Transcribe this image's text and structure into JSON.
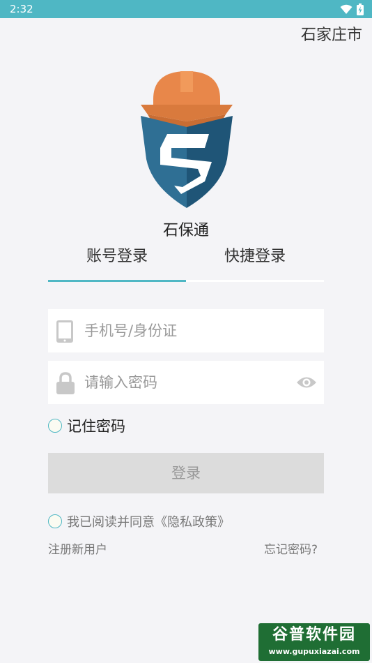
{
  "status_bar": {
    "time": "2:32",
    "icons": [
      "wifi-icon",
      "battery-icon"
    ]
  },
  "header": {
    "city": "石家庄市"
  },
  "app": {
    "name": "石保通",
    "logo_icon": "shield-helmet-logo",
    "colors": {
      "accent": "#4fb7c4",
      "logo_orange": "#e8874a",
      "logo_blue": "#2f6f94"
    }
  },
  "tabs": [
    {
      "label": "账号登录",
      "active": true
    },
    {
      "label": "快捷登录",
      "active": false
    }
  ],
  "form": {
    "phone": {
      "placeholder": "手机号/身份证",
      "value": "",
      "icon": "phone-icon"
    },
    "password": {
      "placeholder": "请输入密码",
      "value": "",
      "icon": "lock-icon",
      "toggle_icon": "eye-icon"
    },
    "remember_label": "记住密码",
    "login_label": "登录",
    "agree_label": "我已阅读并同意《隐私政策》"
  },
  "links": {
    "register": "注册新用户",
    "forgot": "忘记密码?"
  },
  "watermark": {
    "title": "谷普软件园",
    "url": "www.gupuxiazai.com"
  }
}
